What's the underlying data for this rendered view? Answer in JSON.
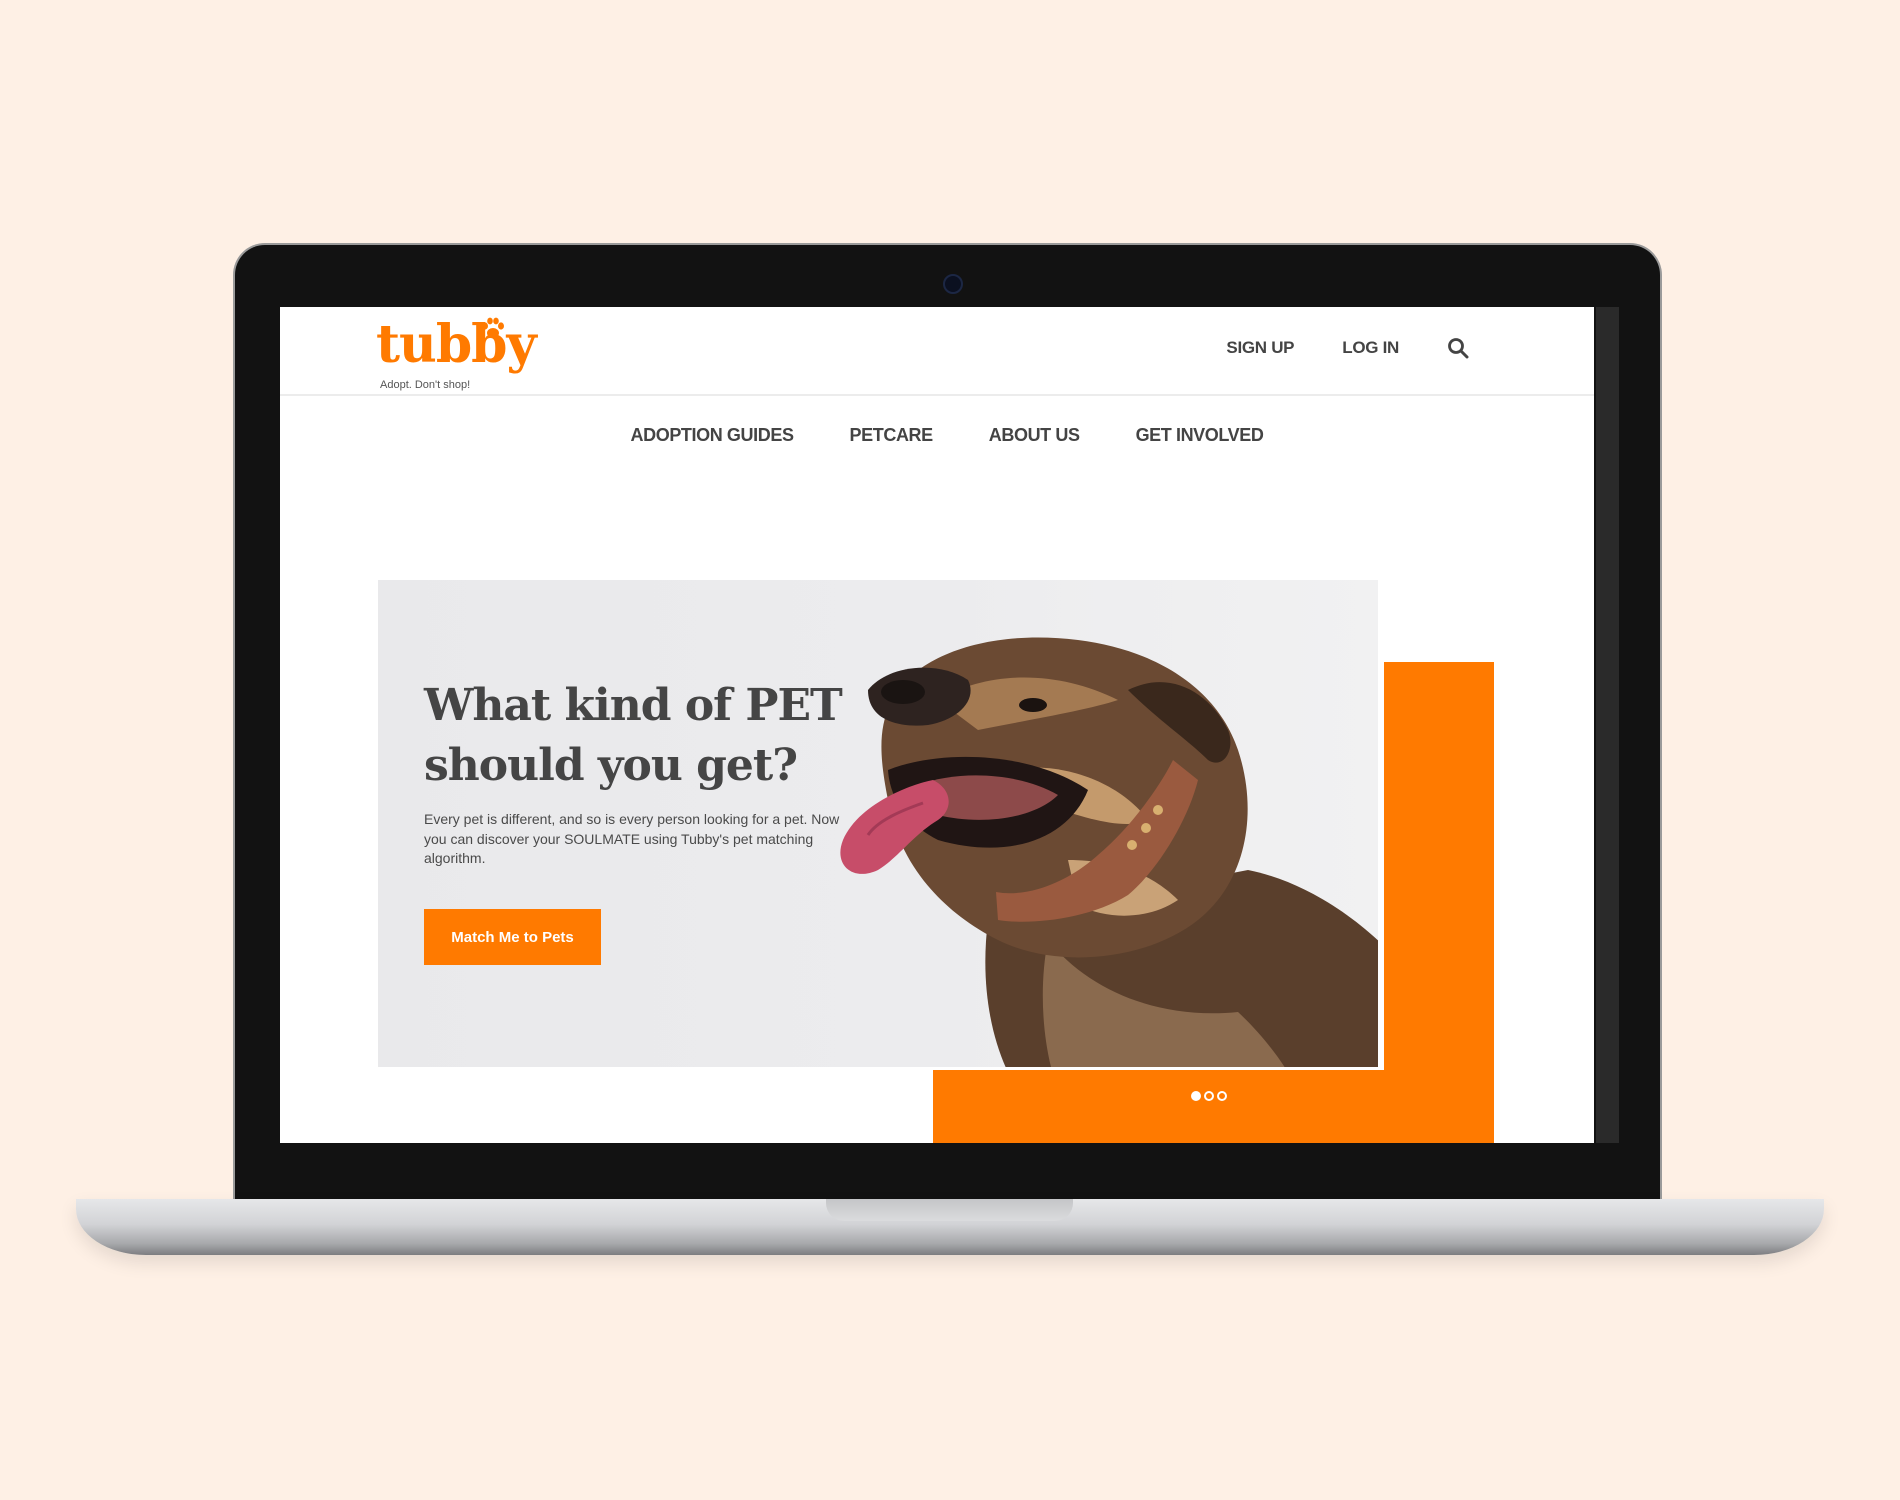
{
  "brand": {
    "name": "tubby",
    "tagline": "Adopt. Don't shop!",
    "accent_color": "#ff7a00"
  },
  "header": {
    "links": [
      "SIGN UP",
      "LOG IN"
    ],
    "search_icon": "search-icon"
  },
  "nav": {
    "items": [
      "ADOPTION GUIDES",
      "PETCARE",
      "ABOUT US",
      "GET INVOLVED"
    ]
  },
  "hero": {
    "title_line1": "What kind of PET",
    "title_line2": "should you get?",
    "description": "Every pet is different, and so is every person looking for a pet. Now you can discover your SOULMATE using Tubby's pet matching algorithm.",
    "cta": "Match Me to Pets",
    "image": "dog-photo"
  },
  "carousel": {
    "slides": 3,
    "active": 1
  }
}
